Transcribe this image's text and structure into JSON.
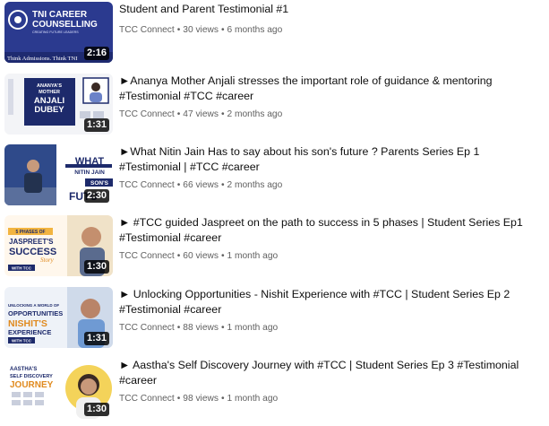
{
  "videos": [
    {
      "title": "Student and Parent Testimonial #1",
      "channel": "TCC Connect",
      "views": "30 views",
      "age": "6 months ago",
      "duration": "2:16",
      "thumb_text": [
        "TNI CAREER",
        "COUNSELLING",
        "CREATING FUTURE LEADERS",
        "Think Admissions. Think TNI"
      ]
    },
    {
      "title": "►Ananya Mother Anjali stresses the important role of guidance & mentoring #Testimonial #TCC #career",
      "channel": "TCC Connect",
      "views": "47 views",
      "age": "2 months ago",
      "duration": "1:31",
      "thumb_text": [
        "ANANYA'S",
        "MOTHER",
        "ANJALI",
        "DUBEY"
      ]
    },
    {
      "title": "►What Nitin Jain Has to say about his son's future ? Parents Series Ep 1 #Testimonial | #TCC #career",
      "channel": "TCC Connect",
      "views": "66 views",
      "age": "2 months ago",
      "duration": "2:30",
      "thumb_text": [
        "WHAT",
        "NITIN JAIN",
        "SON'S",
        "FUTU"
      ]
    },
    {
      "title": "► #TCC guided Jaspreet on the path to success in 5 phases | Student Series Ep1 #Testimonial #career",
      "channel": "TCC Connect",
      "views": "60 views",
      "age": "1 month ago",
      "duration": "1:30",
      "thumb_text": [
        "5 PHASES OF",
        "JASPREET'S",
        "SUCCESS",
        "Story",
        "WITH TCC"
      ]
    },
    {
      "title": "► Unlocking Opportunities - Nishit Experience with #TCC | Student Series Ep 2 #Testimonial #career",
      "channel": "TCC Connect",
      "views": "88 views",
      "age": "1 month ago",
      "duration": "1:31",
      "thumb_text": [
        "UNLOCKING A WORLD OF",
        "OPPORTUNITIES",
        "NISHIT'S",
        "EXPERIENCE",
        "WITH TCC"
      ]
    },
    {
      "title": "► Aastha's Self Discovery Journey with #TCC | Student Series Ep 3 #Testimonial #career",
      "channel": "TCC Connect",
      "views": "98 views",
      "age": "1 month ago",
      "duration": "1:30",
      "thumb_text": [
        "AASTHA'S",
        "SELF DISCOVERY",
        "JOURNEY"
      ]
    }
  ]
}
